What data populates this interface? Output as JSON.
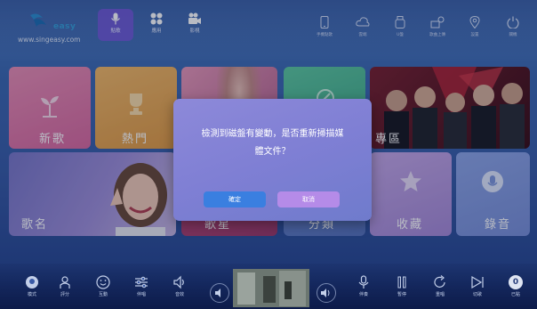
{
  "header": {
    "logo_word": "easy",
    "website": "www.singeasy.com",
    "nav_tabs": [
      {
        "label": "點歌",
        "icon": "microphone-icon",
        "active": true
      },
      {
        "label": "應用",
        "icon": "apps-grid-icon",
        "active": false
      },
      {
        "label": "影視",
        "icon": "video-camera-icon",
        "active": false
      }
    ],
    "tools": [
      {
        "label": "手機點歌",
        "icon": "phone-icon"
      },
      {
        "label": "雲端",
        "icon": "cloud-icon"
      },
      {
        "label": "U盤",
        "icon": "usb-icon"
      },
      {
        "label": "歌曲上傳",
        "icon": "upload-icon"
      },
      {
        "label": "設置",
        "icon": "location-icon"
      },
      {
        "label": "關機",
        "icon": "power-icon"
      }
    ]
  },
  "tiles": {
    "new_songs": "新歌",
    "hot": "熱門",
    "album": "專區",
    "song_name": "歌名",
    "singer": "歌星",
    "category": "分類",
    "favorites": "收藏",
    "record": "錄音"
  },
  "dialog": {
    "message_line1": "檢測到磁盤有變動，是否重新掃描媒",
    "message_line2": "體文件？",
    "ok_label": "確定",
    "cancel_label": "取消"
  },
  "bottom": {
    "left": [
      {
        "label": "模式",
        "icon": "headphone-mode-icon"
      },
      {
        "label": "評分",
        "icon": "score-icon"
      },
      {
        "label": "互動",
        "icon": "smile-icon"
      },
      {
        "label": "伴唱",
        "icon": "equalizer-icon"
      },
      {
        "label": "音效",
        "icon": "speaker-icon"
      }
    ],
    "right": [
      {
        "label": "伴奏",
        "icon": "mic-icon"
      },
      {
        "label": "暫停",
        "icon": "pause-icon"
      },
      {
        "label": "重唱",
        "icon": "replay-icon"
      },
      {
        "label": "切歌",
        "icon": "skip-icon"
      },
      {
        "label": "已點",
        "icon": "queue-count-icon"
      }
    ],
    "queue_count": "0"
  },
  "colors": {
    "dialog_bg": "#8587d8",
    "ok_button": "#3a7fe0",
    "cancel_button": "#b58be8",
    "active_tab": "#7a5ae0"
  }
}
